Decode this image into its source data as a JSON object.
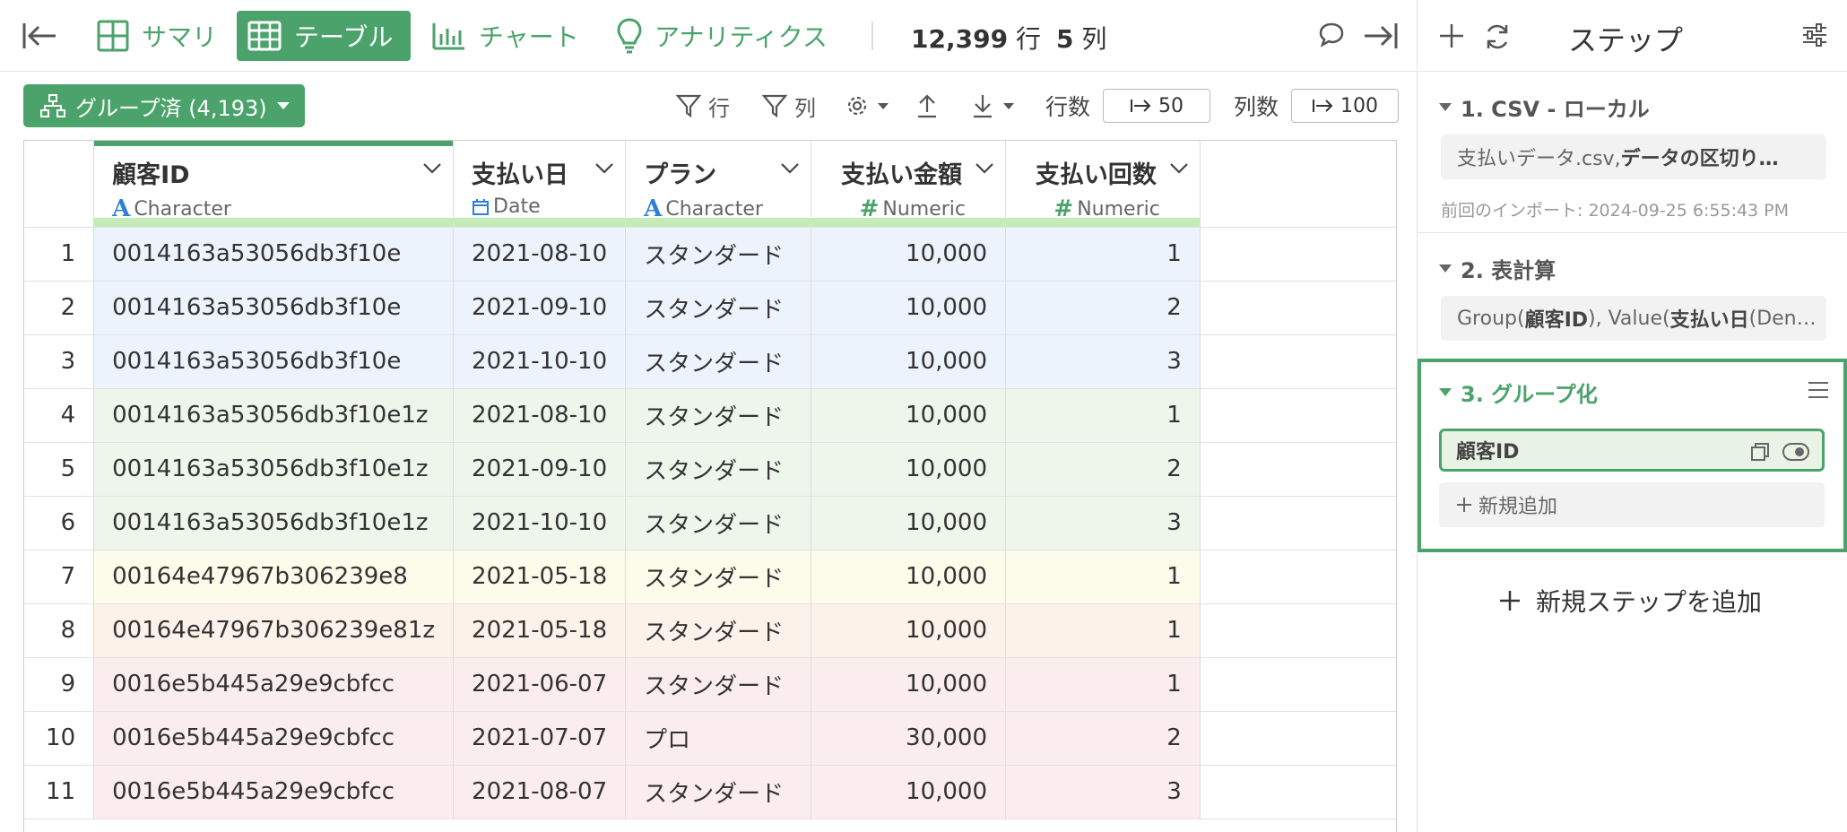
{
  "nav": {
    "tabs": [
      {
        "label": "サマリ",
        "icon": "summary-grid-icon"
      },
      {
        "label": "テーブル",
        "icon": "table-icon"
      },
      {
        "label": "チャート",
        "icon": "bar-chart-icon"
      },
      {
        "label": "アナリティクス",
        "icon": "lightbulb-icon"
      }
    ],
    "row_count": "12,399",
    "row_unit": "行",
    "col_count": "5",
    "col_unit": "列"
  },
  "toolbar": {
    "group_button": "グループ済 (4,193)",
    "filter_row": "行",
    "filter_col": "列",
    "rows_label": "行数",
    "rows_value": "50",
    "cols_label": "列数",
    "cols_value": "100"
  },
  "table": {
    "columns": [
      {
        "name": "顧客ID",
        "type": "Character"
      },
      {
        "name": "支払い日",
        "type": "Date"
      },
      {
        "name": "プラン",
        "type": "Character"
      },
      {
        "name": "支払い金額",
        "type": "Numeric"
      },
      {
        "name": "支払い回数",
        "type": "Numeric"
      }
    ],
    "rows": [
      {
        "idx": "1",
        "id": "0014163a53056db3f10e",
        "date": "2021-08-10",
        "plan": "スタンダード",
        "amount": "10,000",
        "count": "1"
      },
      {
        "idx": "2",
        "id": "0014163a53056db3f10e",
        "date": "2021-09-10",
        "plan": "スタンダード",
        "amount": "10,000",
        "count": "2"
      },
      {
        "idx": "3",
        "id": "0014163a53056db3f10e",
        "date": "2021-10-10",
        "plan": "スタンダード",
        "amount": "10,000",
        "count": "3"
      },
      {
        "idx": "4",
        "id": "0014163a53056db3f10e1z",
        "date": "2021-08-10",
        "plan": "スタンダード",
        "amount": "10,000",
        "count": "1"
      },
      {
        "idx": "5",
        "id": "0014163a53056db3f10e1z",
        "date": "2021-09-10",
        "plan": "スタンダード",
        "amount": "10,000",
        "count": "2"
      },
      {
        "idx": "6",
        "id": "0014163a53056db3f10e1z",
        "date": "2021-10-10",
        "plan": "スタンダード",
        "amount": "10,000",
        "count": "3"
      },
      {
        "idx": "7",
        "id": "00164e47967b306239e8",
        "date": "2021-05-18",
        "plan": "スタンダード",
        "amount": "10,000",
        "count": "1"
      },
      {
        "idx": "8",
        "id": "00164e47967b306239e81z",
        "date": "2021-05-18",
        "plan": "スタンダード",
        "amount": "10,000",
        "count": "1"
      },
      {
        "idx": "9",
        "id": "0016e5b445a29e9cbfcc",
        "date": "2021-06-07",
        "plan": "スタンダード",
        "amount": "10,000",
        "count": "1"
      },
      {
        "idx": "10",
        "id": "0016e5b445a29e9cbfcc",
        "date": "2021-07-07",
        "plan": "プロ",
        "amount": "30,000",
        "count": "2"
      },
      {
        "idx": "11",
        "id": "0016e5b445a29e9cbfcc",
        "date": "2021-08-07",
        "plan": "スタンダード",
        "amount": "10,000",
        "count": "3"
      }
    ]
  },
  "panel": {
    "title": "ステップ",
    "steps": [
      {
        "title": "1. CSV - ローカル",
        "box_plain": "支払いデータ.csv, ",
        "box_bold": "データの区切り…",
        "meta": "前回のインポート: 2024-09-25 6:55:43 PM"
      },
      {
        "title": "2. 表計算",
        "box_a": "Group(",
        "box_b": "顧客ID",
        "box_c": "), Value(",
        "box_d": "支払い日",
        "box_e": " (Den…"
      },
      {
        "title": "3. グループ化",
        "chip": "顧客ID",
        "add_new": "新規追加"
      }
    ],
    "add_step": "新規ステップを追加"
  },
  "colors": {
    "accent": "#4ba36b",
    "blue_row": "#edf3fd",
    "green_row": "#eef6ec",
    "yellow_row": "#fdfbea",
    "peach_row": "#fdf2ea",
    "pink_row": "#fbeded"
  }
}
